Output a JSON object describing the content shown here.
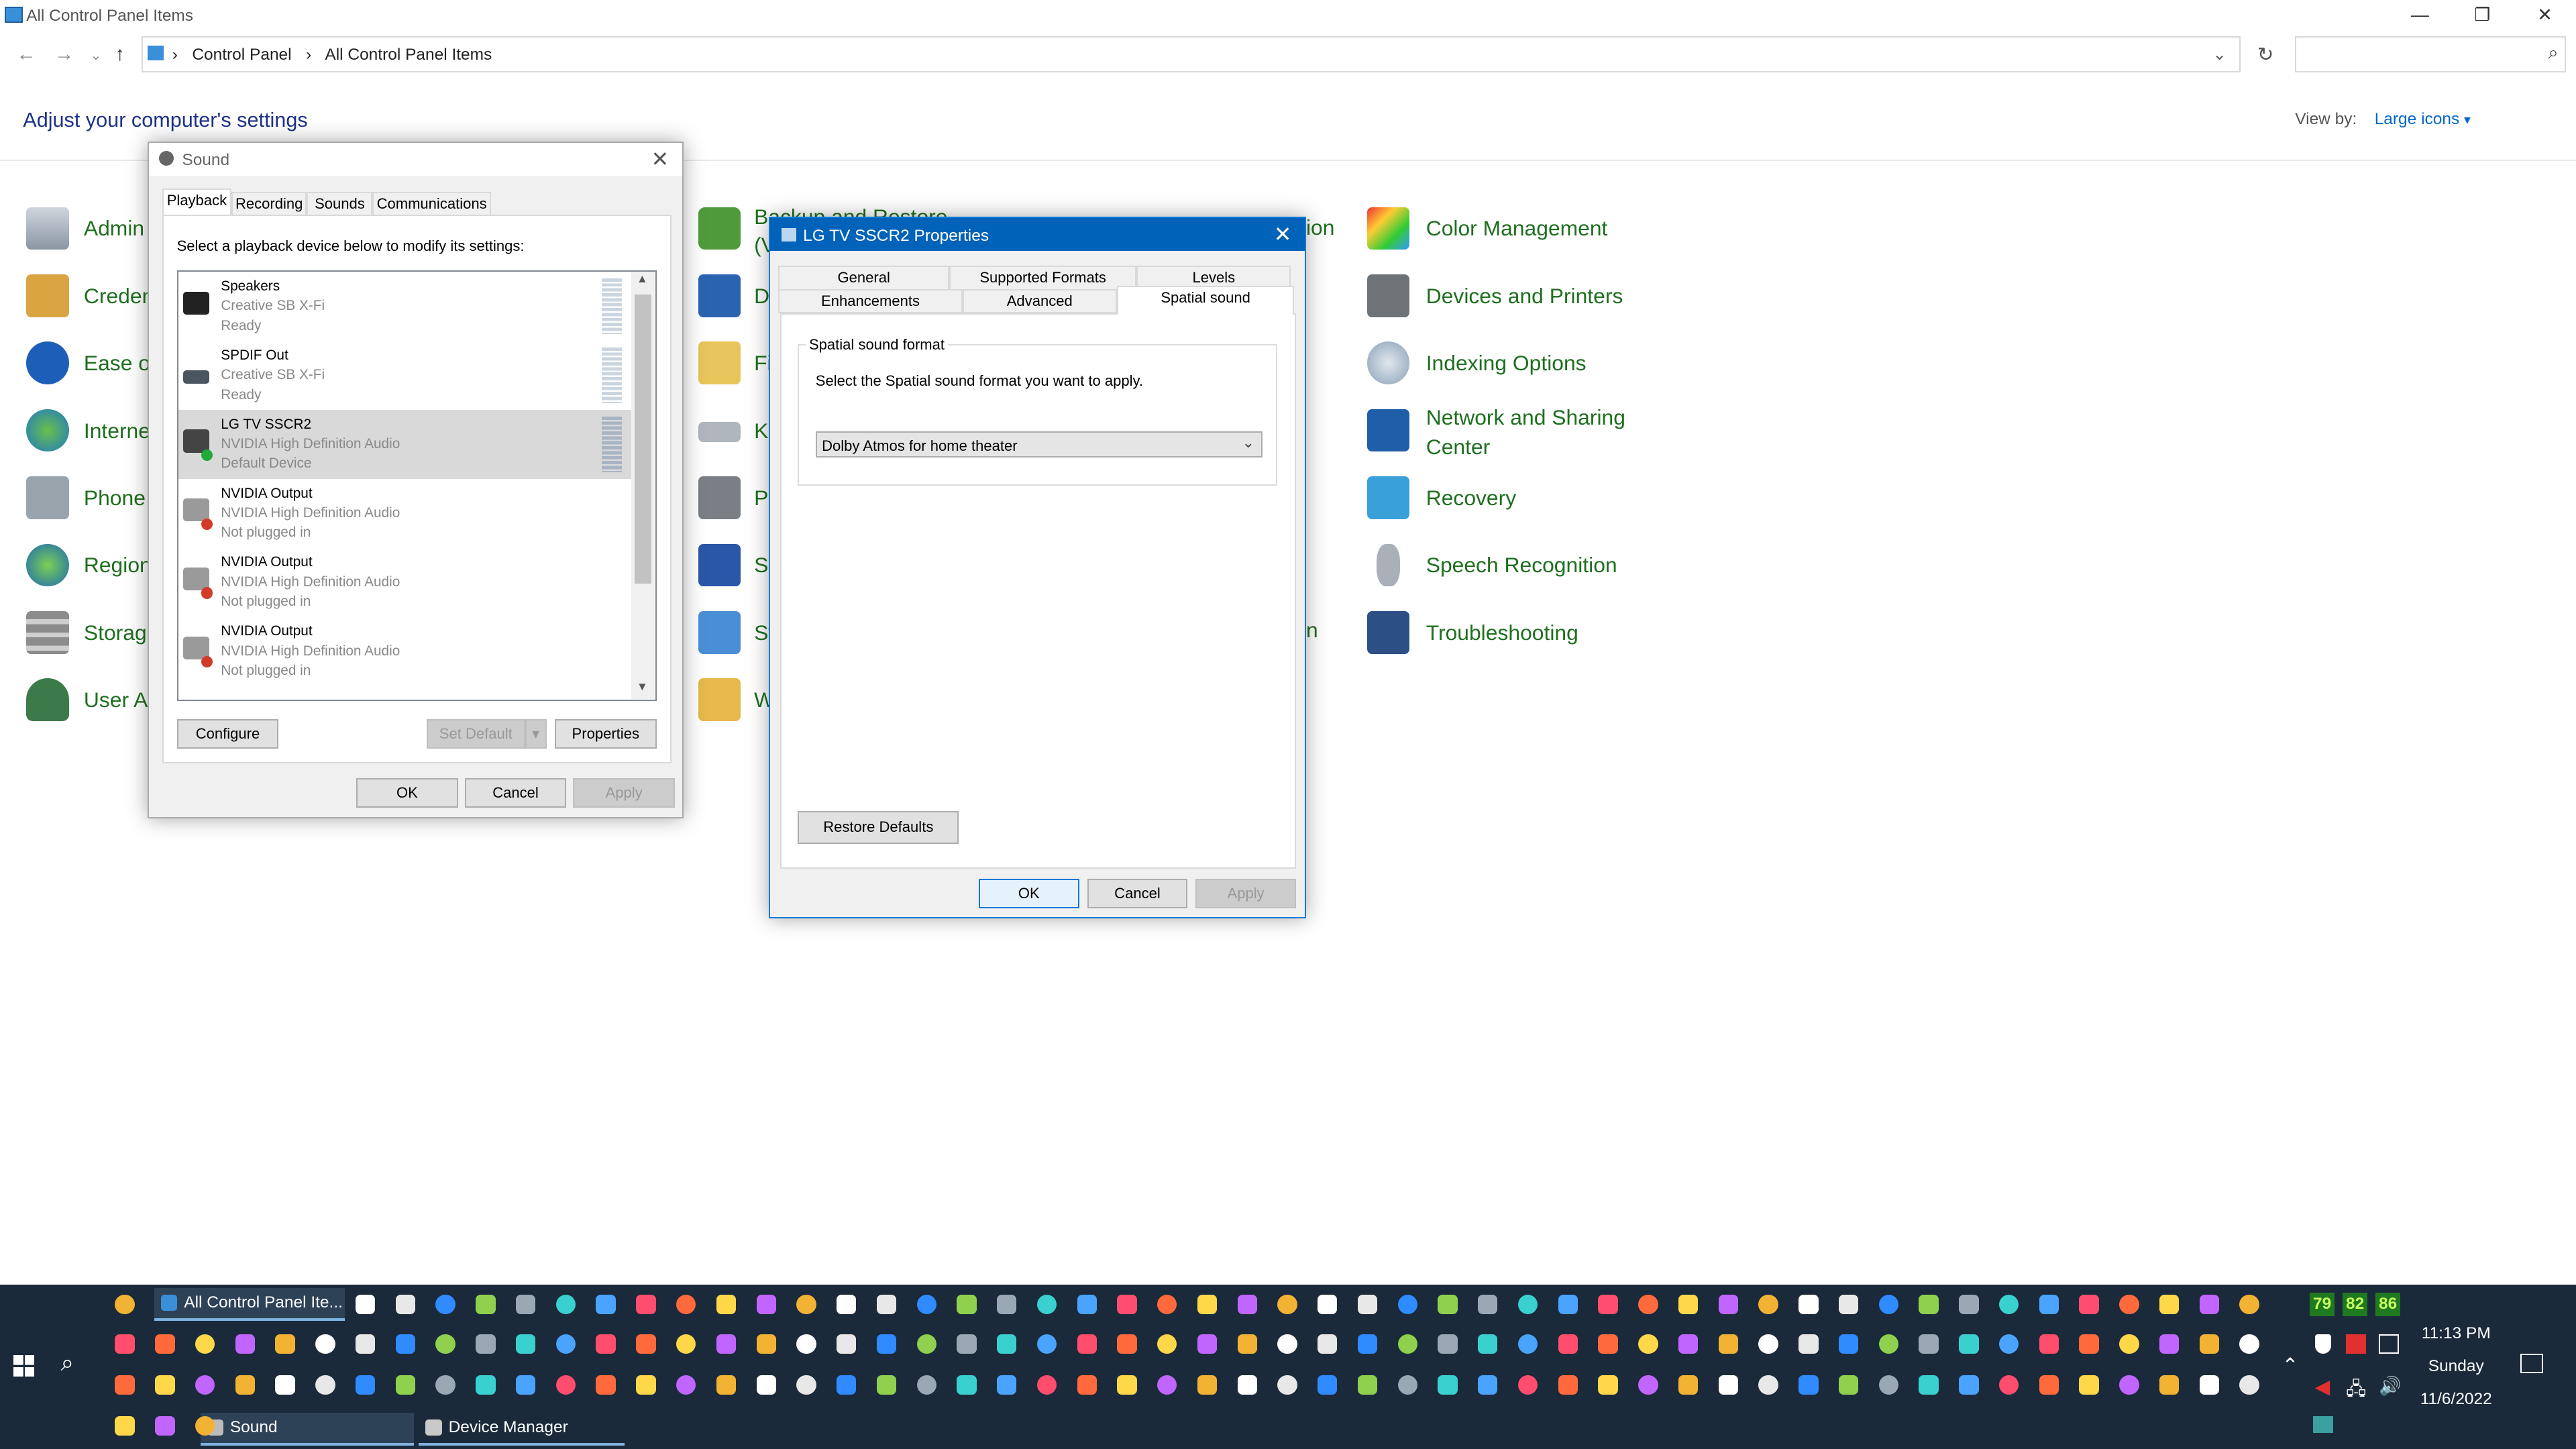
{
  "window": {
    "title": "All Control Panel Items",
    "breadcrumbs": [
      "Control Panel",
      "All Control Panel Items"
    ],
    "heading": "Adjust your computer's settings",
    "view_by_label": "View by:",
    "view_by_value": "Large icons"
  },
  "control_panel_items": {
    "left": [
      "Admin",
      "Creden",
      "Ease of",
      "Interne",
      "Phone",
      "Region",
      "Storag",
      "User A"
    ],
    "middle": [
      "Backup and Restore",
      "D",
      "Fi",
      "K",
      "P",
      "S",
      "Sy",
      "W"
    ],
    "middle_clip": [
      "(V",
      "ion",
      "n"
    ],
    "right": [
      "Color Management",
      "Devices and Printers",
      "Indexing Options",
      "Network and Sharing",
      "Center",
      "Recovery",
      "Speech Recognition",
      "Troubleshooting"
    ]
  },
  "sound_dialog": {
    "title": "Sound",
    "tabs": [
      "Playback",
      "Recording",
      "Sounds",
      "Communications"
    ],
    "instruction": "Select a playback device below to modify its settings:",
    "devices": [
      {
        "name": "Speakers",
        "driver": "Creative SB X-Fi",
        "status": "Ready"
      },
      {
        "name": "SPDIF Out",
        "driver": "Creative SB X-Fi",
        "status": "Ready"
      },
      {
        "name": "LG TV SSCR2",
        "driver": "NVIDIA High Definition Audio",
        "status": "Default Device"
      },
      {
        "name": "NVIDIA Output",
        "driver": "NVIDIA High Definition Audio",
        "status": "Not plugged in"
      },
      {
        "name": "NVIDIA Output",
        "driver": "NVIDIA High Definition Audio",
        "status": "Not plugged in"
      },
      {
        "name": "NVIDIA Output",
        "driver": "NVIDIA High Definition Audio",
        "status": "Not plugged in"
      }
    ],
    "configure": "Configure",
    "set_default": "Set Default",
    "properties": "Properties",
    "ok": "OK",
    "cancel": "Cancel",
    "apply": "Apply"
  },
  "props_dialog": {
    "title": "LG TV SSCR2 Properties",
    "tabs_row1": [
      "General",
      "Supported Formats",
      "Levels"
    ],
    "tabs_row2": [
      "Enhancements",
      "Advanced",
      "Spatial sound"
    ],
    "group_label": "Spatial sound format",
    "instruction": "Select the Spatial sound format you want to apply.",
    "selected_format": "Dolby Atmos for home theater",
    "restore_defaults": "Restore Defaults",
    "ok": "OK",
    "cancel": "Cancel",
    "apply": "Apply"
  },
  "taskbar": {
    "top_task": "All Control Panel Ite...",
    "tasks": [
      "Sound",
      "Device Manager"
    ],
    "temps": [
      "79",
      "82",
      "86"
    ],
    "time": "11:13 PM",
    "day": "Sunday",
    "date": "11/6/2022"
  }
}
